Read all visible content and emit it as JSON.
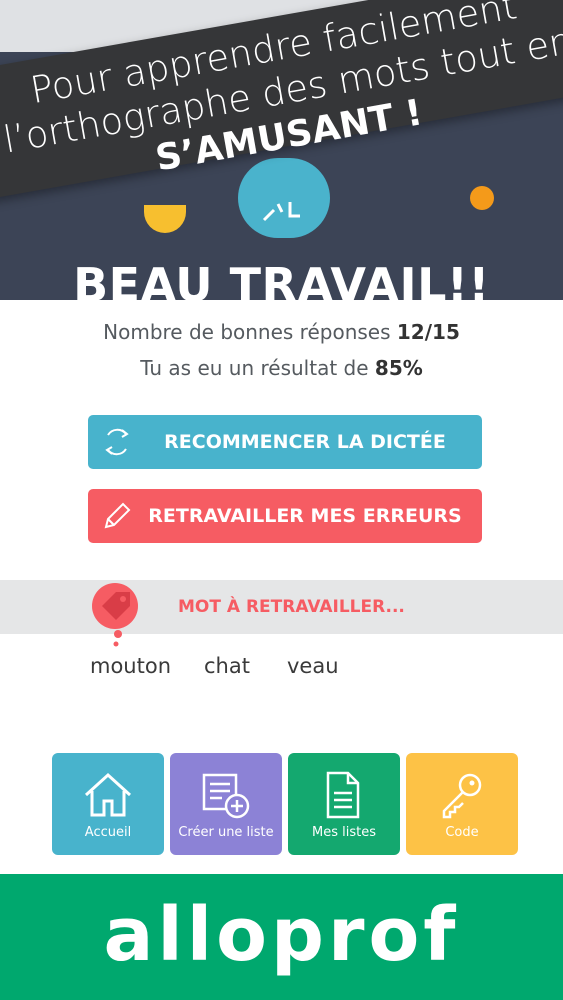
{
  "promo": {
    "line1": "Pour apprendre facilement",
    "line2": "l’orthographe des mots tout en",
    "line3": "S’AMUSANT !"
  },
  "result": {
    "title": "BEAU TRAVAIL!!",
    "correct_label": "Nombre de bonnes réponses",
    "correct_value": "12/15",
    "score_label": "Tu as eu un résultat de",
    "score_value": "85%"
  },
  "actions": {
    "restart_label": "RECOMMENCER LA DICTÉE",
    "errors_label": "RETRAVAILLER MES ERREURS"
  },
  "review": {
    "title": "MOT À RETRAVAILLER...",
    "words": [
      "mouton",
      "chat",
      "veau"
    ]
  },
  "nav": {
    "items": [
      {
        "label": "Accueil",
        "icon": "home-icon",
        "color": "#48b3cc"
      },
      {
        "label": "Créer une liste",
        "icon": "create-list-icon",
        "color": "#8c82d6"
      },
      {
        "label": "Mes listes",
        "icon": "document-icon",
        "color": "#14a86f"
      },
      {
        "label": "Code",
        "icon": "key-icon",
        "color": "#fdc246"
      }
    ]
  },
  "footer": {
    "brand": "alloprof",
    "color": "#00a86e"
  },
  "colors": {
    "header_bg": "#3c4456",
    "accent_blue": "#48b3cc",
    "accent_red": "#f65c63"
  }
}
